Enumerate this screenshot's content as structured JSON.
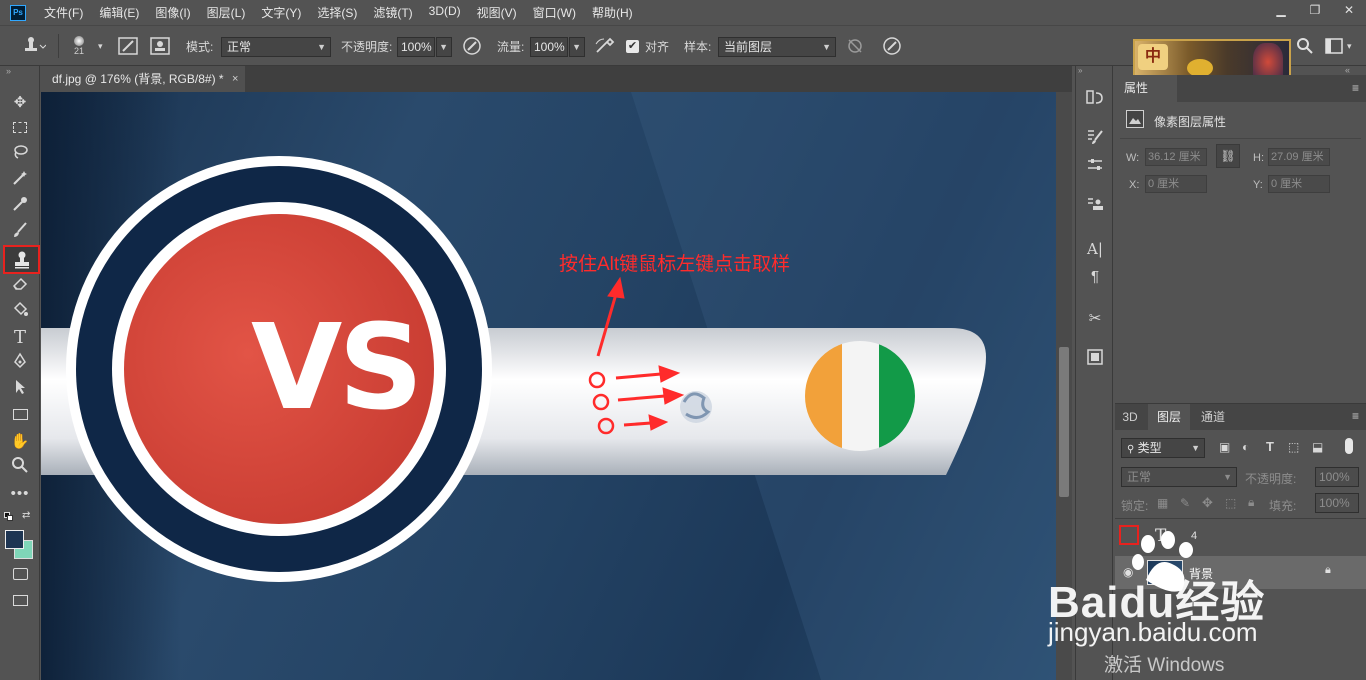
{
  "menubar": {
    "logo": "Ps",
    "items": [
      "文件(F)",
      "编辑(E)",
      "图像(I)",
      "图层(L)",
      "文字(Y)",
      "选择(S)",
      "滤镜(T)",
      "3D(D)",
      "视图(V)",
      "窗口(W)",
      "帮助(H)"
    ]
  },
  "options": {
    "brush_size": "21",
    "mode_label": "模式:",
    "mode_value": "正常",
    "opacity_label": "不透明度:",
    "opacity_value": "100%",
    "flow_label": "流量:",
    "flow_value": "100%",
    "align_label": "对齐",
    "sample_label": "样本:",
    "sample_value": "当前图层"
  },
  "document": {
    "tab_title": "df.jpg @ 176% (背景, RGB/8#) *",
    "close": "×"
  },
  "canvas": {
    "vs_text": "VS",
    "annotation": "按住Alt键鼠标左键点击取样"
  },
  "properties": {
    "tab": "属性",
    "section": "像素图层属性",
    "w_label": "W:",
    "w_value": "36.12 厘米",
    "h_label": "H:",
    "h_value": "27.09 厘米",
    "x_label": "X:",
    "x_value": "0 厘米",
    "y_label": "Y:",
    "y_value": "0 厘米"
  },
  "layers": {
    "tabs": [
      "3D",
      "图层",
      "通道"
    ],
    "filter_value": "类型",
    "blend_value": "正常",
    "opacity_label": "不透明度:",
    "opacity_value": "100%",
    "lock_label": "锁定:",
    "fill_label": "填充:",
    "fill_value": "100%",
    "rows": [
      {
        "type_glyph": "T",
        "name": "4"
      },
      {
        "name": "背景"
      }
    ]
  },
  "watermark": {
    "baidu": "Baidu经验",
    "url": "jingyan.baidu.com",
    "activate": "激活 Windows"
  },
  "colors": {
    "annotation_red": "#ff2b2b",
    "highlight_box": "#e8221e",
    "vs_red": "#d9473a",
    "vs_navy": "#0f2747"
  }
}
